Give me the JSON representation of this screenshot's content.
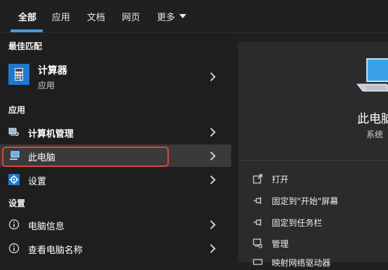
{
  "tabs": [
    {
      "label": "全部"
    },
    {
      "label": "应用"
    },
    {
      "label": "文档"
    },
    {
      "label": "网页"
    },
    {
      "label": "更多"
    }
  ],
  "sections": {
    "best_match": "最佳匹配",
    "apps": "应用",
    "settings": "设置"
  },
  "best_match": {
    "title": "计算器",
    "subtitle": "应用"
  },
  "results": {
    "computer_management": "计算机管理",
    "this_pc": "此电脑",
    "settings_app": "设置",
    "pc_info": "电脑信息",
    "view_pc_name": "查看电脑名称"
  },
  "detail": {
    "title": "此电脑",
    "subtitle": "系统"
  },
  "actions": [
    {
      "label": "打开",
      "icon": "open-icon"
    },
    {
      "label": "固定到\"开始\"屏幕",
      "icon": "pin-icon"
    },
    {
      "label": "固定到任务栏",
      "icon": "pin-icon"
    },
    {
      "label": "管理",
      "icon": "manage-icon"
    },
    {
      "label": "映射网络驱动器",
      "icon": "map-drive-icon"
    }
  ],
  "colors": {
    "accent": "#4a9bd8",
    "highlight_box": "#d9453b",
    "selected_bg": "#3a3a3a"
  }
}
